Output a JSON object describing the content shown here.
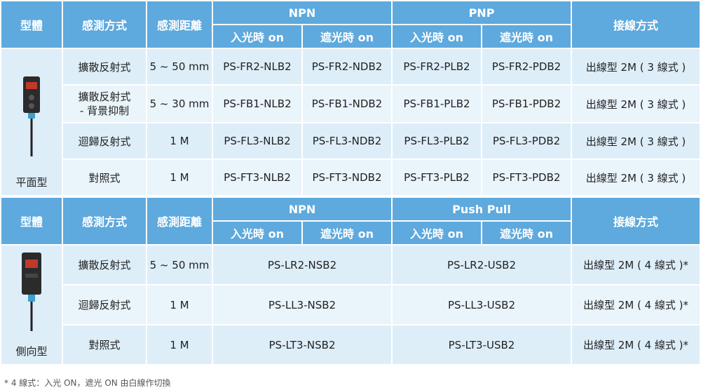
{
  "table1": {
    "headers": {
      "type": "型體",
      "method": "感測方式",
      "distance": "感測距離",
      "group1": "NPN",
      "group2": "PNP",
      "wiring": "接線方式",
      "sub": [
        "入光時 on",
        "遮光時 on",
        "入光時 on",
        "遮光時 on"
      ]
    },
    "type_label": "平面型",
    "sensor_icon": "flat-photoelectric-sensor-icon",
    "rows": [
      {
        "method": "擴散反射式",
        "distance": "5 ~ 50 mm",
        "c1": "PS-FR2-NLB2",
        "c2": "PS-FR2-NDB2",
        "c3": "PS-FR2-PLB2",
        "c4": "PS-FR2-PDB2",
        "wiring": "出線型 2M ( 3 線式 )"
      },
      {
        "method": "擴散反射式\n- 背景抑制",
        "distance": "5 ~ 30 mm",
        "c1": "PS-FB1-NLB2",
        "c2": "PS-FB1-NDB2",
        "c3": "PS-FB1-PLB2",
        "c4": "PS-FB1-PDB2",
        "wiring": "出線型 2M ( 3 線式 )"
      },
      {
        "method": "迴歸反射式",
        "distance": "1 M",
        "c1": "PS-FL3-NLB2",
        "c2": "PS-FL3-NDB2",
        "c3": "PS-FL3-PLB2",
        "c4": "PS-FL3-PDB2",
        "wiring": "出線型 2M ( 3 線式 )"
      },
      {
        "method": "對照式",
        "distance": "1 M",
        "c1": "PS-FT3-NLB2",
        "c2": "PS-FT3-NDB2",
        "c3": "PS-FT3-PLB2",
        "c4": "PS-FT3-PDB2",
        "wiring": "出線型 2M ( 3 線式 )"
      }
    ]
  },
  "table2": {
    "headers": {
      "type": "型體",
      "method": "感測方式",
      "distance": "感測距離",
      "group1": "NPN",
      "group2": "Push Pull",
      "wiring": "接線方式",
      "sub": [
        "入光時 on",
        "遮光時 on",
        "入光時 on",
        "遮光時 on"
      ]
    },
    "type_label": "側向型",
    "sensor_icon": "side-photoelectric-sensor-icon",
    "rows": [
      {
        "method": "擴散反射式",
        "distance": "5 ~ 50 mm",
        "npn": "PS-LR2-NSB2",
        "pp": "PS-LR2-USB2",
        "wiring": "出線型 2M ( 4 線式 )*"
      },
      {
        "method": "迴歸反射式",
        "distance": "1 M",
        "npn": "PS-LL3-NSB2",
        "pp": "PS-LL3-USB2",
        "wiring": "出線型 2M ( 4 線式 )*"
      },
      {
        "method": "對照式",
        "distance": "1 M",
        "npn": "PS-LT3-NSB2",
        "pp": "PS-LT3-USB2",
        "wiring": "出線型 2M ( 4 線式 )*"
      }
    ]
  },
  "footnote": "* 4 線式：入光 ON，遮光 ON 由白線作切換",
  "colors": {
    "header": "#5ea9dd",
    "cell": "#ddeef9",
    "cell_alt": "#eaf4fb"
  }
}
